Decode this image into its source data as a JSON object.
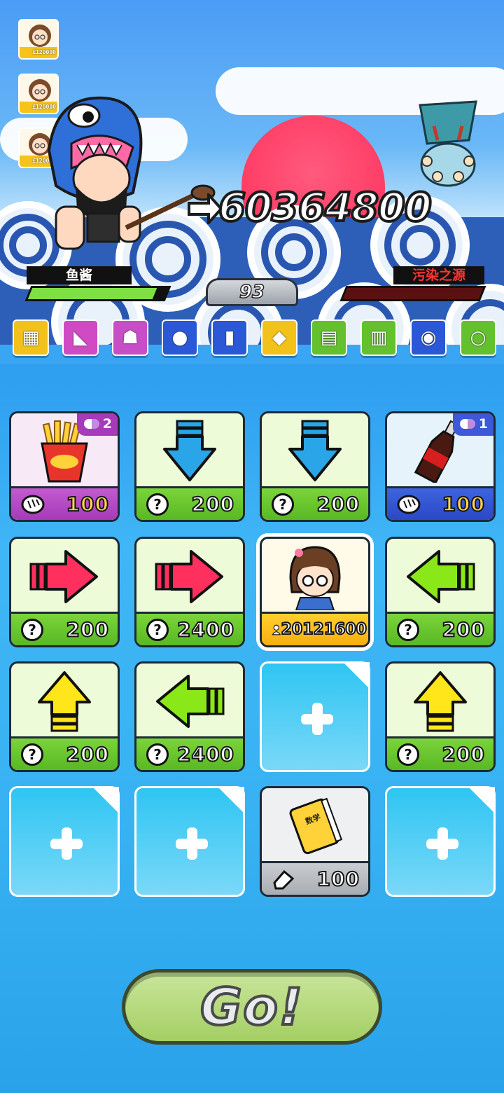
{
  "roster": [
    {
      "score": "£120000"
    },
    {
      "score": "£120000"
    },
    {
      "score": "£120000"
    }
  ],
  "battle": {
    "damage": "60364800",
    "round": "93",
    "player": {
      "name": "鱼酱",
      "hp_fraction": 0.92,
      "color": "#7ee042"
    },
    "enemy": {
      "name": "污染之源",
      "hp_fraction": 0.0,
      "color": "#7a1a1a"
    }
  },
  "strip_items": [
    {
      "name": "cash-box-icon",
      "bg": "#f2c21b",
      "glyph": "▦"
    },
    {
      "name": "cheese-icon",
      "bg": "#d04ac4",
      "glyph": "◣"
    },
    {
      "name": "robot-icon",
      "bg": "#c84ec8",
      "glyph": "☗"
    },
    {
      "name": "egg-nest-icon",
      "bg": "#2a58d6",
      "glyph": "●"
    },
    {
      "name": "battery-icon",
      "bg": "#2a58d6",
      "glyph": "▮"
    },
    {
      "name": "shopping-bag-icon",
      "bg": "#f2c21b",
      "glyph": "◆"
    },
    {
      "name": "document-icon",
      "bg": "#64c12e",
      "glyph": "▤"
    },
    {
      "name": "board-icon",
      "bg": "#64c12e",
      "glyph": "▥"
    },
    {
      "name": "frying-pan-icon",
      "bg": "#2a58d6",
      "glyph": "◉"
    },
    {
      "name": "green-orb-icon",
      "bg": "#64c12e",
      "glyph": "○"
    }
  ],
  "cards": [
    {
      "name": "fries-card",
      "type": "item",
      "art": "fries",
      "cost": "100",
      "bar": "purple",
      "icon": "bread",
      "badge": "2",
      "badge_color": "purple"
    },
    {
      "name": "arrow-down-card",
      "type": "item",
      "art": "down",
      "cost": "200",
      "bar": "green",
      "icon": "?"
    },
    {
      "name": "arrow-down-card",
      "type": "item",
      "art": "down",
      "cost": "200",
      "bar": "green",
      "icon": "?"
    },
    {
      "name": "cola-card",
      "type": "item",
      "art": "cola",
      "cost": "100",
      "bar": "blue",
      "icon": "bread",
      "badge": "1",
      "badge_color": "blue"
    },
    {
      "name": "arrow-right-card",
      "type": "item",
      "art": "right",
      "cost": "200",
      "bar": "green",
      "icon": "?"
    },
    {
      "name": "arrow-right-card",
      "type": "item",
      "art": "right",
      "cost": "2400",
      "bar": "green",
      "icon": "?"
    },
    {
      "name": "girl-character-card",
      "type": "item",
      "art": "girl",
      "cost": "20121600",
      "bar": "yellow",
      "icon": "person",
      "selected": true
    },
    {
      "name": "arrow-left-card",
      "type": "item",
      "art": "left",
      "cost": "200",
      "bar": "green",
      "icon": "?"
    },
    {
      "name": "arrow-up-card",
      "type": "item",
      "art": "up",
      "cost": "200",
      "bar": "green",
      "icon": "?"
    },
    {
      "name": "arrow-left-card",
      "type": "item",
      "art": "left",
      "cost": "2400",
      "bar": "green",
      "icon": "?"
    },
    {
      "name": "empty-slot",
      "type": "empty"
    },
    {
      "name": "arrow-up-card",
      "type": "item",
      "art": "up",
      "cost": "200",
      "bar": "green",
      "icon": "?"
    },
    {
      "name": "empty-slot",
      "type": "empty"
    },
    {
      "name": "empty-slot",
      "type": "empty"
    },
    {
      "name": "math-book-card",
      "type": "item",
      "art": "book",
      "cost": "100",
      "bar": "gray",
      "icon": "eraser",
      "book_label": "数学"
    },
    {
      "name": "empty-slot",
      "type": "empty"
    }
  ],
  "go_label": "Go!"
}
